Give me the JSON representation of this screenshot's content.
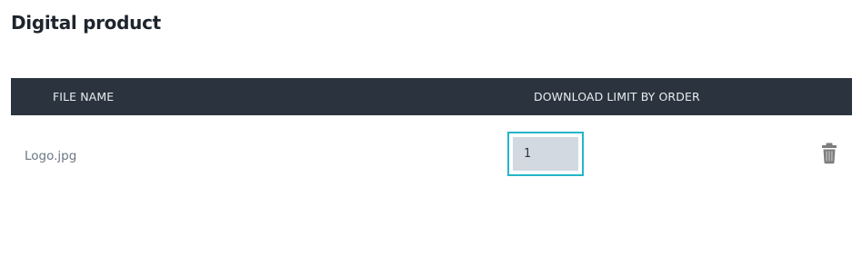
{
  "page": {
    "title": "Digital product"
  },
  "table": {
    "headers": {
      "file_name": "FILE NAME",
      "download_limit": "DOWNLOAD LIMIT BY ORDER"
    },
    "rows": [
      {
        "file_name": "Logo.jpg",
        "download_limit": "1",
        "action_icon": "trash-icon"
      }
    ]
  },
  "colors": {
    "header_bg": "#2b343e",
    "focus_border": "#25b5c9",
    "input_bg": "#d2d9e0",
    "trash_icon": "#7d7d7d"
  }
}
